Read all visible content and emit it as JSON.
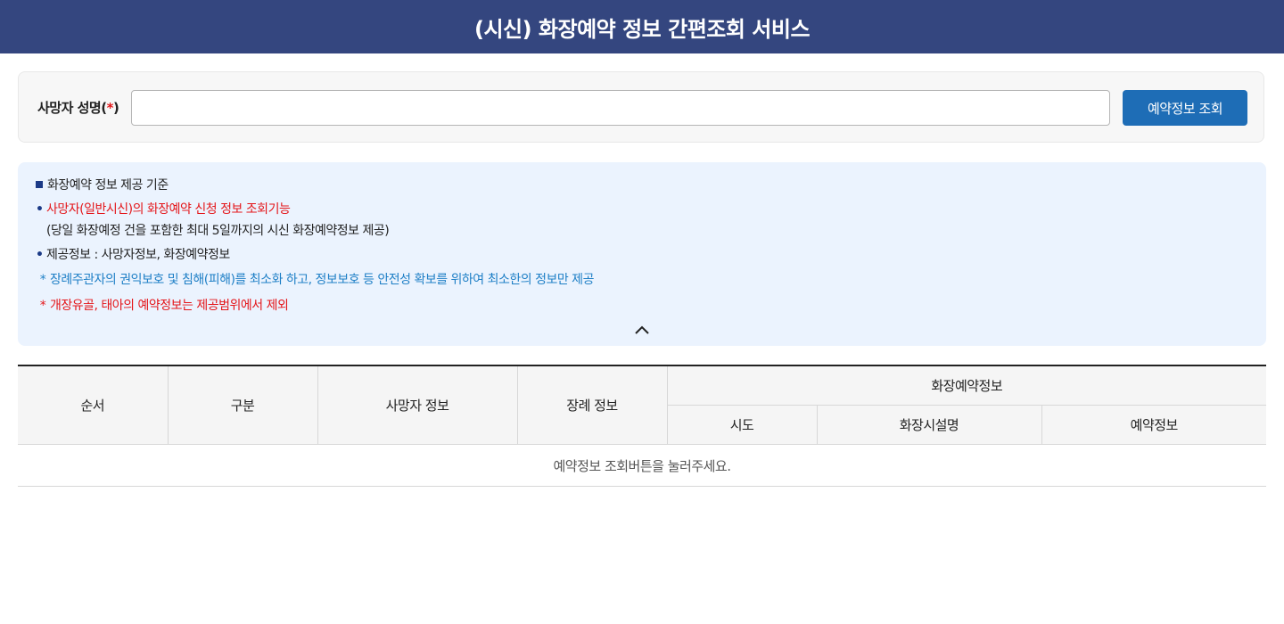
{
  "header": {
    "title": "(시신) 화장예약 정보 간편조회 서비스"
  },
  "search": {
    "label": "사망자 성명",
    "label_open": "(",
    "required_mark": "*",
    "label_close": ")",
    "value": "",
    "placeholder": "",
    "button_label": "예약정보 조회"
  },
  "info": {
    "heading": "화장예약 정보 제공 기준",
    "bullet_symbol": "•",
    "star_symbol": "*",
    "item1": "사망자(일반시신)의 화장예약 신청 정보 조회기능",
    "item1_sub": "(당일 화장예정 건을 포함한 최대 5일까지의 시신 화장예약정보 제공)",
    "item2": "제공정보 : 사망자정보, 화장예약정보",
    "note1": "장례주관자의 권익보호 및 침해(피해)를 최소화 하고, 정보보호 등 안전성 확보를 위하여 최소한의 정보만 제공",
    "note2": "개장유골, 태아의 예약정보는 제공범위에서 제외",
    "collapse_icon": "chevron-up-icon"
  },
  "table": {
    "headers": {
      "order": "순서",
      "category": "구분",
      "deceased_info": "사망자 정보",
      "funeral_info": "장례 정보",
      "cremation_group": "화장예약정보",
      "region": "시도",
      "facility": "화장시설명",
      "reservation": "예약정보"
    },
    "empty_message": "예약정보 조회버튼을 눌러주세요."
  },
  "colors": {
    "header_bg": "#34467f",
    "button_bg": "#1e6db6",
    "info_bg": "#ebf3fe",
    "required": "#e4161a",
    "note_blue": "#1e7fc6"
  }
}
